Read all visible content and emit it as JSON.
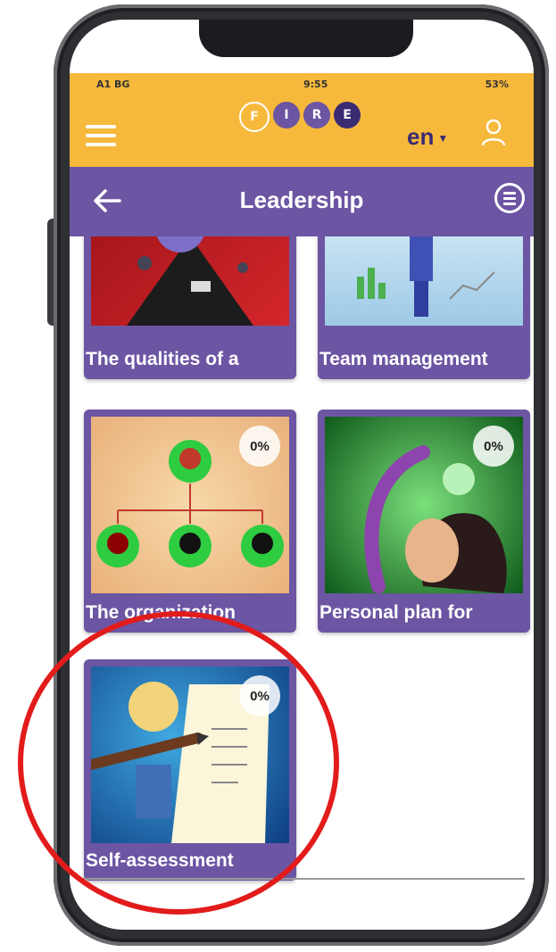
{
  "status": {
    "carrier": "A1 BG",
    "time": "9:55",
    "battery": "53%"
  },
  "header": {
    "logo_letters": [
      "F",
      "I",
      "R",
      "E"
    ],
    "logo_colors": [
      "#f6b93b",
      "#6c55a3",
      "#6c55a3",
      "#3b2b73"
    ],
    "language": "en"
  },
  "titlebar": {
    "title": "Leadership"
  },
  "modules": [
    {
      "label": "The qualities of a"
    },
    {
      "label": "Team management"
    },
    {
      "label": "The organization",
      "progress": "0%"
    },
    {
      "label": "Personal plan for",
      "progress": "0%"
    },
    {
      "label": "Self-assessment",
      "progress": "0%"
    }
  ],
  "colors": {
    "topbar": "#f6b93b",
    "accent": "#6c55a3",
    "highlight": "#e21b1b"
  }
}
